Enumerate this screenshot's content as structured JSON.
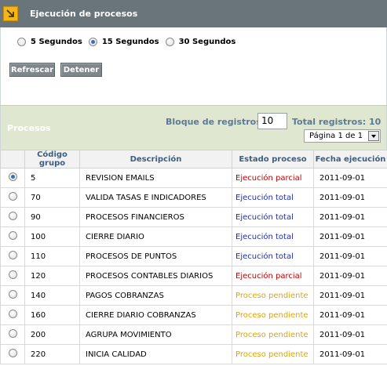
{
  "header": {
    "title": "Ejecución de procesos"
  },
  "refresh_options": {
    "items": [
      {
        "label": "5 Segundos",
        "checked": false
      },
      {
        "label": "15 Segundos",
        "checked": true
      },
      {
        "label": "30 Segundos",
        "checked": false
      }
    ]
  },
  "toolbar": {
    "refresh_label": "Refrescar",
    "stop_label": "Detener"
  },
  "processes": {
    "title": "Procesos",
    "block_label": "Bloque de registros:",
    "block_value": "10",
    "total_label": "Total registros: 10",
    "page_label": "Página 1 de 1"
  },
  "table": {
    "columns": [
      "",
      "Código grupo",
      "Descripción",
      "Estado proceso",
      "Fecha ejecución"
    ],
    "rows": [
      {
        "selected": true,
        "code": "5",
        "description": "REVISION EMAILS",
        "status": "Ejecución parcial",
        "status_kind": "parcial",
        "date": "2011-09-01"
      },
      {
        "selected": false,
        "code": "70",
        "description": "VALIDA TASAS E INDICADORES",
        "status": "Ejecución total",
        "status_kind": "total",
        "date": "2011-09-01"
      },
      {
        "selected": false,
        "code": "90",
        "description": "PROCESOS FINANCIEROS",
        "status": "Ejecución total",
        "status_kind": "total",
        "date": "2011-09-01"
      },
      {
        "selected": false,
        "code": "100",
        "description": "CIERRE DIARIO",
        "status": "Ejecución total",
        "status_kind": "total",
        "date": "2011-09-01"
      },
      {
        "selected": false,
        "code": "110",
        "description": "PROCESOS DE PUNTOS",
        "status": "Ejecución total",
        "status_kind": "total",
        "date": "2011-09-01"
      },
      {
        "selected": false,
        "code": "120",
        "description": "PROCESOS CONTABLES DIARIOS",
        "status": "Ejecución parcial",
        "status_kind": "parcial",
        "date": "2011-09-01"
      },
      {
        "selected": false,
        "code": "140",
        "description": "PAGOS COBRANZAS",
        "status": "Proceso pendiente",
        "status_kind": "pend",
        "date": "2011-09-01"
      },
      {
        "selected": false,
        "code": "160",
        "description": "CIERRE DIARIO COBRANZAS",
        "status": "Proceso pendiente",
        "status_kind": "pend",
        "date": "2011-09-01"
      },
      {
        "selected": false,
        "code": "200",
        "description": "AGRUPA MOVIMIENTO",
        "status": "Proceso pendiente",
        "status_kind": "pend",
        "date": "2011-09-01"
      },
      {
        "selected": false,
        "code": "220",
        "description": "INICIA CALIDAD",
        "status": "Proceso pendiente",
        "status_kind": "pend",
        "date": "2011-09-01"
      }
    ]
  },
  "colors": {
    "header_bg": "#69747b",
    "accent_icon": "#f2b51b",
    "panel_bg": "#dfe7d0",
    "status_parcial": "#c00000",
    "status_total": "#1f2fa8",
    "status_pendiente": "#e2a400"
  },
  "icons": {
    "header": "expand-arrow-icon",
    "pager": "chevron-down-icon"
  }
}
